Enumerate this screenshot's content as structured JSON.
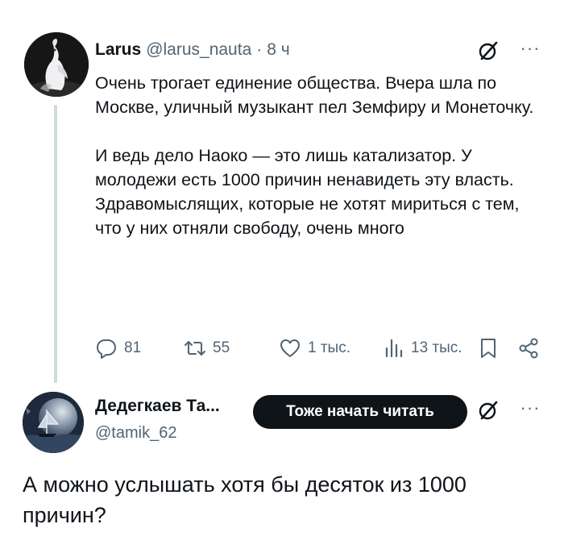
{
  "post": {
    "author_name": "Larus",
    "author_handle": "@larus_nauta",
    "separator": "·",
    "time": "8 ч",
    "more": "···",
    "text": "Очень трогает единение общества. Вчера шла по Москве, уличный музыкант пел Земфиру и Монеточку.\n\nИ ведь дело Наоко — это лишь катализатор. У молодежи есть 1000 причин ненавидеть эту власть. Здравомыслящих, которые не хотят мириться с тем, что у них отняли свободу, очень много",
    "actions": {
      "replies": "81",
      "reposts": "55",
      "likes": "1 тыс.",
      "views": "13 тыс."
    }
  },
  "reply": {
    "author_name": "Дедегкаев Та...",
    "author_handle": "@tamik_62",
    "follow_label": "Тоже начать читать",
    "more": "···",
    "text": "А можно услышать хотя бы десяток из 1000 причин?"
  },
  "colors": {
    "text": "#0f1419",
    "secondary": "#536471",
    "thread_line": "#cfd9de",
    "button_bg": "#0f1419"
  },
  "icons": [
    "grok-icon",
    "more-icon",
    "reply-icon",
    "repost-icon",
    "like-icon",
    "views-icon",
    "bookmark-icon",
    "share-icon"
  ]
}
